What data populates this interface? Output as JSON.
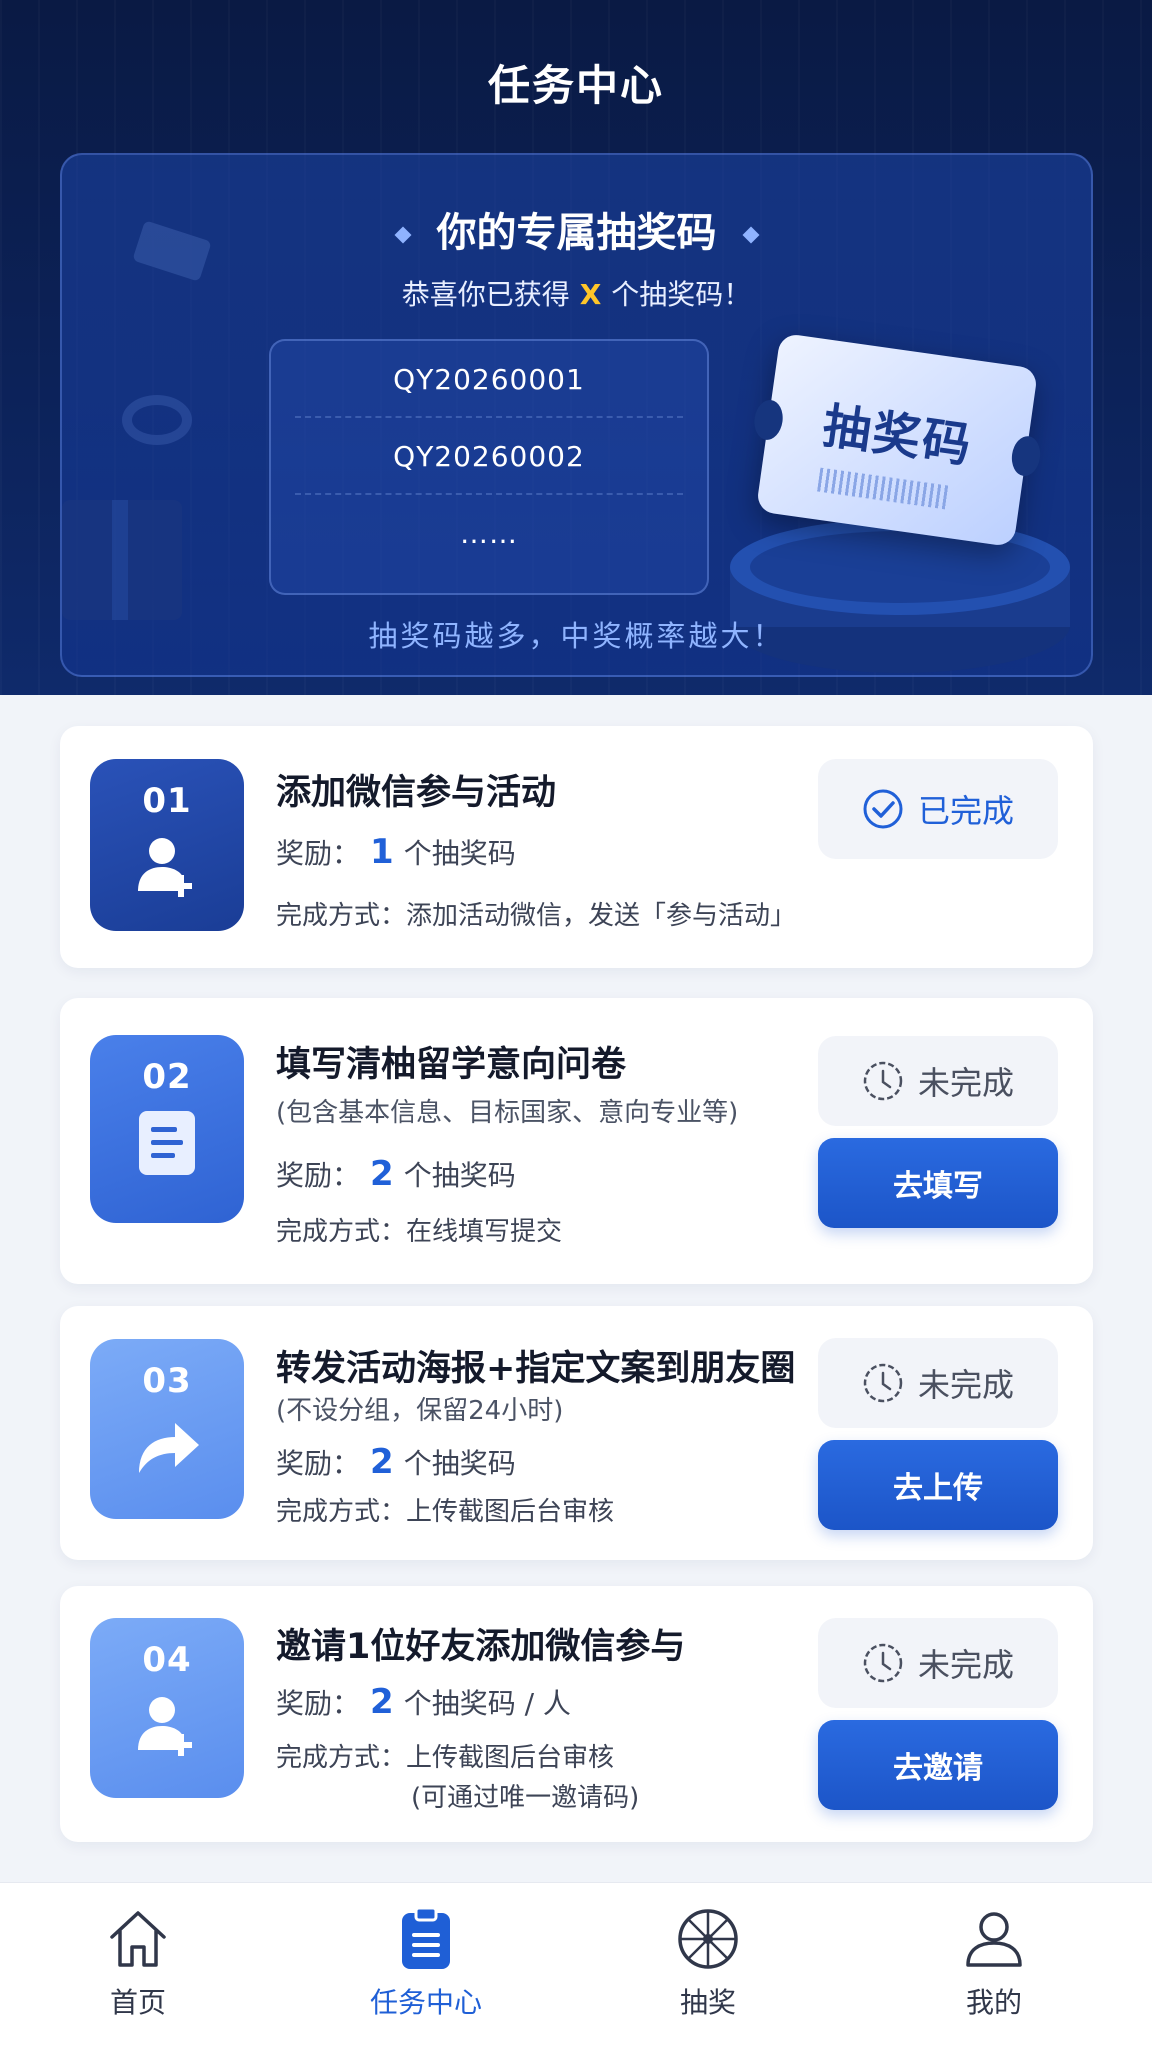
{
  "header": {
    "title": "任务中心"
  },
  "codes": {
    "title": "你的专属抽奖码",
    "subtitle_prefix": "恭喜你已获得",
    "count": "X",
    "subtitle_suffix": "个抽奖码！",
    "list": [
      "QY20260001",
      "QY20260002",
      "……"
    ],
    "footer": "抽奖码越多，中奖概率越大！",
    "ticket_label": "抽奖码"
  },
  "tasks": [
    {
      "num": "01",
      "title": "添加微信参与活动",
      "note": "",
      "reward_label": "奖励：",
      "reward_count": "1",
      "reward_unit": "个抽奖码",
      "method": "完成方式：添加活动微信，发送「参与活动」",
      "status": "已完成",
      "status_icon": "check-circle-icon",
      "action": ""
    },
    {
      "num": "02",
      "title": "填写清柚留学意向问卷",
      "note": "(包含基本信息、目标国家、意向专业等)",
      "reward_label": "奖励：",
      "reward_count": "2",
      "reward_unit": "个抽奖码",
      "method": "完成方式：在线填写提交",
      "status": "未完成",
      "status_icon": "clock-icon",
      "action": "去填写"
    },
    {
      "num": "03",
      "title": "转发活动海报+指定文案到朋友圈",
      "note": "(不设分组，保留24小时)",
      "reward_label": "奖励：",
      "reward_count": "2",
      "reward_unit": "个抽奖码",
      "method": "完成方式：上传截图后台审核",
      "status": "未完成",
      "status_icon": "clock-icon",
      "action": "去上传"
    },
    {
      "num": "04",
      "title": "邀请1位好友添加微信参与",
      "note": "",
      "reward_label": "奖励：",
      "reward_count": "2",
      "reward_unit": "个抽奖码 / 人",
      "method": "完成方式：上传截图后台审核",
      "method_note": "(可通过唯一邀请码)",
      "status": "未完成",
      "status_icon": "clock-icon",
      "action": "去邀请"
    }
  ],
  "tabbar": [
    {
      "label": "首页",
      "icon": "home-icon",
      "active": false
    },
    {
      "label": "任务中心",
      "icon": "clipboard-icon",
      "active": true
    },
    {
      "label": "抽奖",
      "icon": "wheel-icon",
      "active": false
    },
    {
      "label": "我的",
      "icon": "user-icon",
      "active": false
    }
  ],
  "colors": {
    "accent": "#2060d8",
    "header_bg": "#0c2259",
    "highlight": "#ffc629"
  }
}
